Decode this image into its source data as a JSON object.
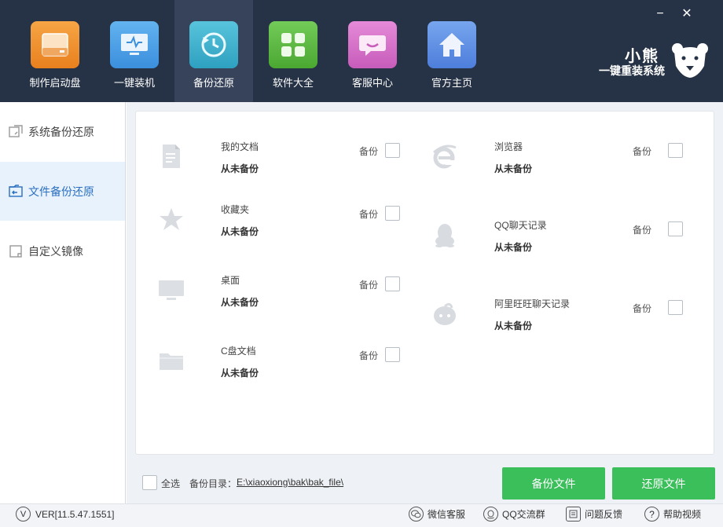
{
  "window": {
    "minimize": "−",
    "close": "✕"
  },
  "nav": [
    {
      "label": "制作启动盘",
      "icon": "usb-drive-icon",
      "color": "#f0922d"
    },
    {
      "label": "一键装机",
      "icon": "monitor-icon",
      "color": "#4ea2e6"
    },
    {
      "label": "备份还原",
      "icon": "restore-icon",
      "color": "#3fb3cf"
    },
    {
      "label": "软件大全",
      "icon": "apps-grid-icon",
      "color": "#5dbb45"
    },
    {
      "label": "客服中心",
      "icon": "chat-bubble-icon",
      "color": "#d86fc9"
    },
    {
      "label": "官方主页",
      "icon": "home-icon",
      "color": "#5d8fe6"
    }
  ],
  "brand": {
    "name": "小熊",
    "slogan": "一键重装系统"
  },
  "sidebar": {
    "items": [
      {
        "label": "系统备份还原"
      },
      {
        "label": "文件备份还原"
      },
      {
        "label": "自定义镜像"
      }
    ]
  },
  "entries": [
    {
      "name": "我的文档",
      "status": "从未备份",
      "backup_label": "备份",
      "icon": "document-icon"
    },
    {
      "name": "收藏夹",
      "status": "从未备份",
      "backup_label": "备份",
      "icon": "star-icon"
    },
    {
      "name": "桌面",
      "status": "从未备份",
      "backup_label": "备份",
      "icon": "desktop-icon"
    },
    {
      "name": "C盘文档",
      "status": "从未备份",
      "backup_label": "备份",
      "icon": "folder-icon"
    },
    {
      "name": "浏览器",
      "status": "从未备份",
      "backup_label": "备份",
      "icon": "browser-ie-icon"
    },
    {
      "name": "QQ聊天记录",
      "status": "从未备份",
      "backup_label": "备份",
      "icon": "qq-penguin-icon"
    },
    {
      "name": "阿里旺旺聊天记录",
      "status": "从未备份",
      "backup_label": "备份",
      "icon": "aliwangwang-icon"
    }
  ],
  "bottom": {
    "select_all": "全选",
    "dir_label": "备份目录：",
    "dir_path": "E:\\xiaoxiong\\bak\\bak_file\\",
    "backup_button": "备份文件",
    "restore_button": "还原文件"
  },
  "footer": {
    "version": "VER[11.5.47.1551]",
    "version_icon_glyph": "V",
    "links": [
      {
        "label": "微信客服",
        "icon": "wechat-icon"
      },
      {
        "label": "QQ交流群",
        "icon": "qq-icon"
      },
      {
        "label": "问题反馈",
        "icon": "feedback-icon"
      },
      {
        "label": "帮助视频",
        "icon": "help-icon",
        "glyph": "?"
      }
    ]
  },
  "colors": {
    "header_bg": "#263245",
    "accent_green": "#3bbf5b",
    "sidebar_active": "#e8f2fc"
  }
}
